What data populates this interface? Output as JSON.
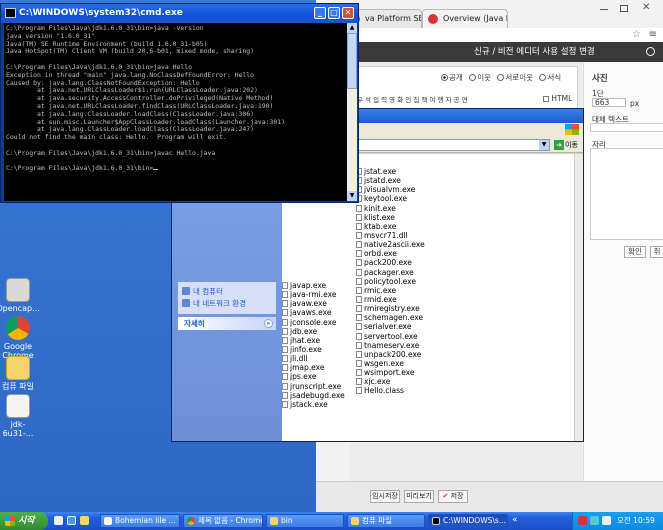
{
  "cmd": {
    "title": "C:\\WINDOWS\\system32\\cmd.exe",
    "lines": [
      "C:\\Program Files\\Java\\jdk1.6.0_31\\bin>java -version",
      "java version \"1.6.0_31\"",
      "Java(TM) SE Runtime Environment (build 1.6.0_31-b05)",
      "Java HotSpot(TM) Client VM (build 20.6-b01, mixed mode, sharing)",
      "",
      "C:\\Program Files\\Java\\jdk1.6.0_31\\bin>java Hello",
      "Exception in thread \"main\" java.lang.NoClassDefFoundError: Hello",
      "Caused by: java.lang.ClassNotFoundException: Hello",
      "        at java.net.URLClassLoader$1.run(URLClassLoader.java:202)",
      "        at java.security.AccessController.doPrivileged(Native Method)",
      "        at java.net.URLClassLoader.findClass(URLClassLoader.java:190)",
      "        at java.lang.ClassLoader.loadClass(ClassLoader.java:306)",
      "        at sun.misc.Launcher$AppClassLoader.loadClass(Launcher.java:301)",
      "        at java.lang.ClassLoader.loadClass(ClassLoader.java:247)",
      "Could not find the main class: Hello.  Program will exit.",
      "",
      "C:\\Program Files\\Java\\jdk1.6.0_31\\bin>javac Hello.java",
      "",
      "C:\\Program Files\\Java\\jdk1.6.0_31\\bin>"
    ]
  },
  "chrome": {
    "tabs": [
      "va Platform SE 6",
      "Overview (Java Platform"
    ],
    "header_text": "신규 / 비전 에디터 사용 설정 변경",
    "visibility_options": [
      "공개",
      "이웃",
      "서로이웃",
      "서식"
    ],
    "html_label": "HTML",
    "post_toolbar_text": "우 석 입 력   영 화   인 집   책   여 행 지   공 연",
    "right_panel": {
      "title": "사진",
      "size_label": "1단",
      "width_value": "663",
      "unit": "px",
      "alt_label": "대체 텍스트",
      "position_label": "자리",
      "confirm_button": "확인",
      "cancel_button": "취"
    },
    "bottom_buttons": [
      "임시저장",
      "미리보기",
      "저장"
    ]
  },
  "explorer": {
    "go_label": "이동",
    "left_links": [
      "내 컴퓨터",
      "내 네트워크 환경"
    ],
    "details_header": "자세히",
    "files_col1": [
      "javap.exe",
      "java-rmi.exe",
      "javaw.exe",
      "javaws.exe",
      "jconsole.exe",
      "jdb.exe",
      "jhat.exe",
      "jinfo.exe",
      "jli.dll",
      "jmap.exe",
      "jps.exe",
      "jrunscript.exe",
      "jsadebugd.exe",
      "jstack.exe"
    ],
    "files_col2": [
      "jstat.exe",
      "jstatd.exe",
      "jvisualvm.exe",
      "keytool.exe",
      "kinit.exe",
      "klist.exe",
      "ktab.exe",
      "msvcr71.dll",
      "native2ascii.exe",
      "orbd.exe",
      "pack200.exe",
      "packager.exe",
      "policytool.exe",
      "rmic.exe",
      "rmid.exe",
      "rmiregistry.exe",
      "schemagen.exe",
      "serialver.exe",
      "servertool.exe",
      "tnameserv.exe",
      "unpack200.exe",
      "wsgen.exe",
      "wsimport.exe",
      "xjc.exe",
      "Hello.class"
    ]
  },
  "desktop": {
    "icons": [
      "Opencap...",
      "Google Chrome",
      "컴퓨 파일",
      "jdk-6u31-..."
    ]
  },
  "taskbar": {
    "start": "시작",
    "tasks": [
      "Bohemian lile ...",
      "제목 없음 - Chrome",
      "bin",
      "컴퓨 파일",
      "C:\\WINDOWS\\s..."
    ],
    "clock": "오전 10:59"
  },
  "colors": {
    "desktop": "#3a7bd5",
    "titlebar": "#0f4fd6",
    "close": "#d7502e",
    "taskbar": "#245edb",
    "start": "#2f8a2f"
  }
}
